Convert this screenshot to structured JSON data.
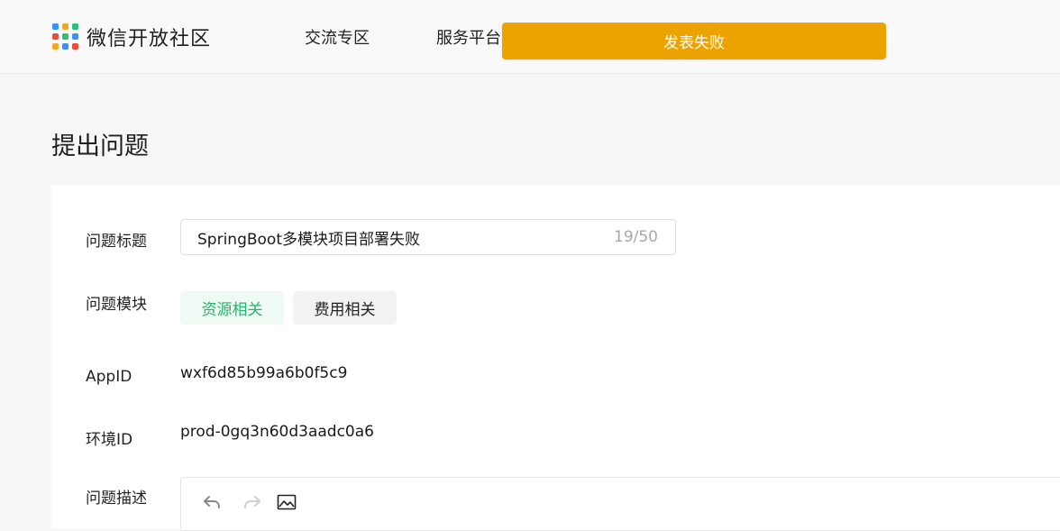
{
  "header": {
    "logo_text": "微信开放社区",
    "nav": [
      {
        "label": "交流专区"
      },
      {
        "label": "服务平台"
      }
    ]
  },
  "toast": {
    "message": "发表失败",
    "color": "#eca300"
  },
  "page": {
    "title": "提出问题"
  },
  "form": {
    "title_label": "问题标题",
    "title_value": "SpringBoot多模块项目部署失败",
    "title_counter": "19/50",
    "module_label": "问题模块",
    "modules": [
      {
        "label": "资源相关",
        "selected": true
      },
      {
        "label": "费用相关",
        "selected": false
      }
    ],
    "appid_label": "AppID",
    "appid_value": "wxf6d85b99a6b0f5c9",
    "env_label": "环境ID",
    "env_value": "prod-0gq3n60d3aadc0a6",
    "desc_label": "问题描述",
    "editor_tools": [
      {
        "icon": "undo-icon"
      },
      {
        "icon": "redo-icon"
      },
      {
        "icon": "image-icon"
      }
    ]
  },
  "colors": {
    "accent_green": "#27b36b",
    "toast_orange": "#eca300"
  }
}
